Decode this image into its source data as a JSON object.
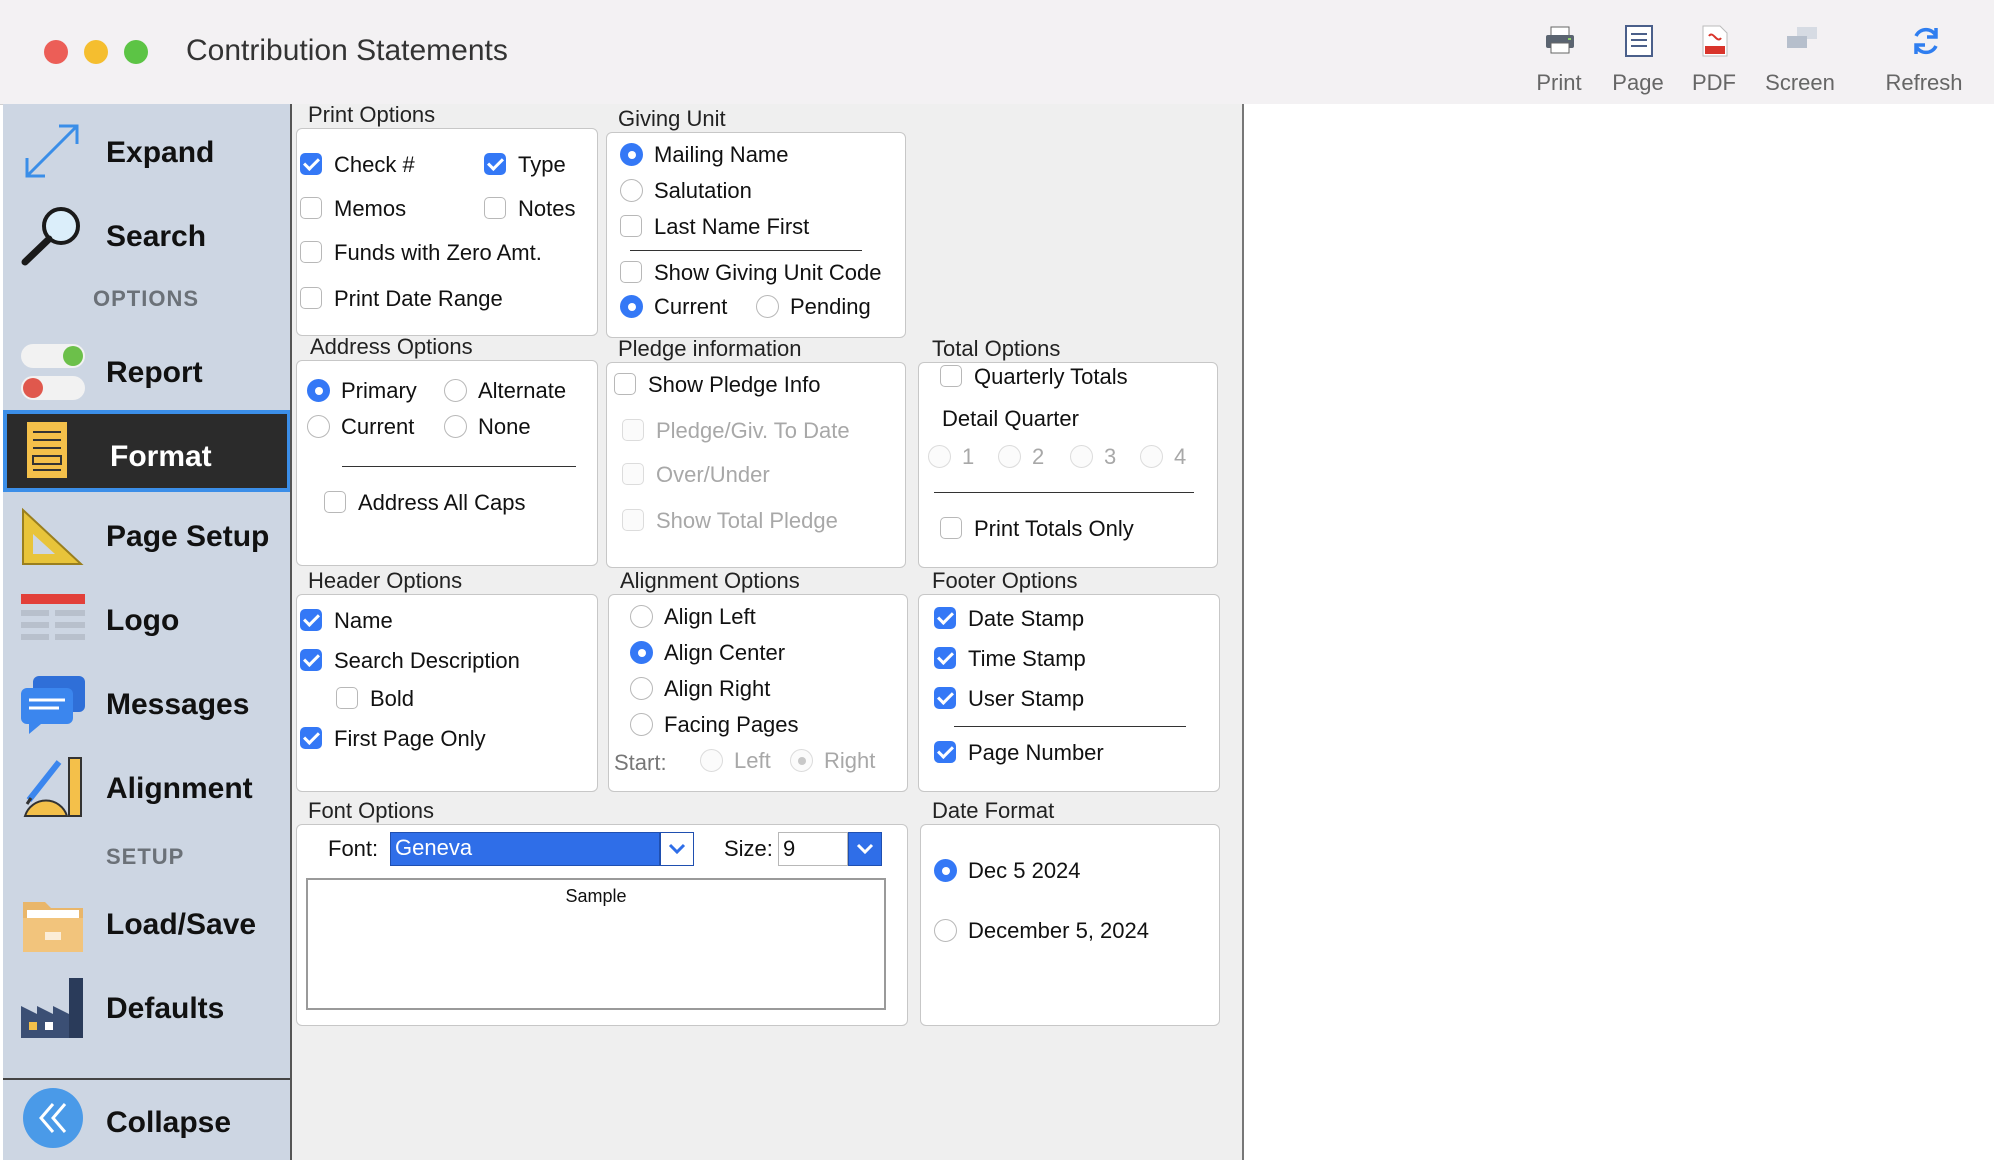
{
  "window": {
    "title": "Contribution Statements"
  },
  "toolbar": {
    "print": "Print",
    "page": "Page",
    "pdf": "PDF",
    "screen": "Screen",
    "refresh": "Refresh"
  },
  "sidebar": {
    "expand": "Expand",
    "search": "Search",
    "options_heading": "OPTIONS",
    "report": "Report",
    "format": "Format",
    "page_setup": "Page Setup",
    "logo": "Logo",
    "messages": "Messages",
    "alignment": "Alignment",
    "setup_heading": "SETUP",
    "load_save": "Load/Save",
    "defaults": "Defaults",
    "collapse": "Collapse"
  },
  "print_options": {
    "title": "Print Options",
    "check_num": "Check #",
    "type": "Type",
    "memos": "Memos",
    "notes": "Notes",
    "funds_zero": "Funds with Zero Amt.",
    "print_date_range": "Print Date Range"
  },
  "giving_unit": {
    "title": "Giving Unit",
    "mailing_name": "Mailing Name",
    "salutation": "Salutation",
    "last_name_first": "Last Name First",
    "show_code": "Show Giving Unit Code",
    "current": "Current",
    "pending": "Pending"
  },
  "address_options": {
    "title": "Address Options",
    "primary": "Primary",
    "alternate": "Alternate",
    "current": "Current",
    "none": "None",
    "all_caps": "Address All Caps"
  },
  "pledge_info": {
    "title": "Pledge information",
    "show": "Show Pledge Info",
    "to_date": "Pledge/Giv. To Date",
    "over_under": "Over/Under",
    "show_total": "Show Total Pledge"
  },
  "total_options": {
    "title": "Total Options",
    "quarterly": "Quarterly Totals",
    "detail_quarter": "Detail Quarter",
    "q1": "1",
    "q2": "2",
    "q3": "3",
    "q4": "4",
    "print_totals_only": "Print Totals Only"
  },
  "header_options": {
    "title": "Header Options",
    "name": "Name",
    "search_desc": "Search Description",
    "bold": "Bold",
    "first_page_only": "First Page Only"
  },
  "alignment_options": {
    "title": "Alignment Options",
    "left": "Align Left",
    "center": "Align Center",
    "right": "Align Right",
    "facing": "Facing Pages",
    "start": "Start:",
    "start_left": "Left",
    "start_right": "Right"
  },
  "footer_options": {
    "title": "Footer Options",
    "date_stamp": "Date Stamp",
    "time_stamp": "Time Stamp",
    "user_stamp": "User Stamp",
    "page_number": "Page Number"
  },
  "font_options": {
    "title": "Font Options",
    "font_label": "Font:",
    "font_value": "Geneva",
    "size_label": "Size:",
    "size_value": "9",
    "sample": "Sample"
  },
  "date_format": {
    "title": "Date Format",
    "short": "Dec 5 2024",
    "long": "December 5, 2024"
  },
  "colors": {
    "accent": "#3478f6",
    "sidebar_bg": "#cdd6e3",
    "selected_bg": "#2b2b2b"
  }
}
